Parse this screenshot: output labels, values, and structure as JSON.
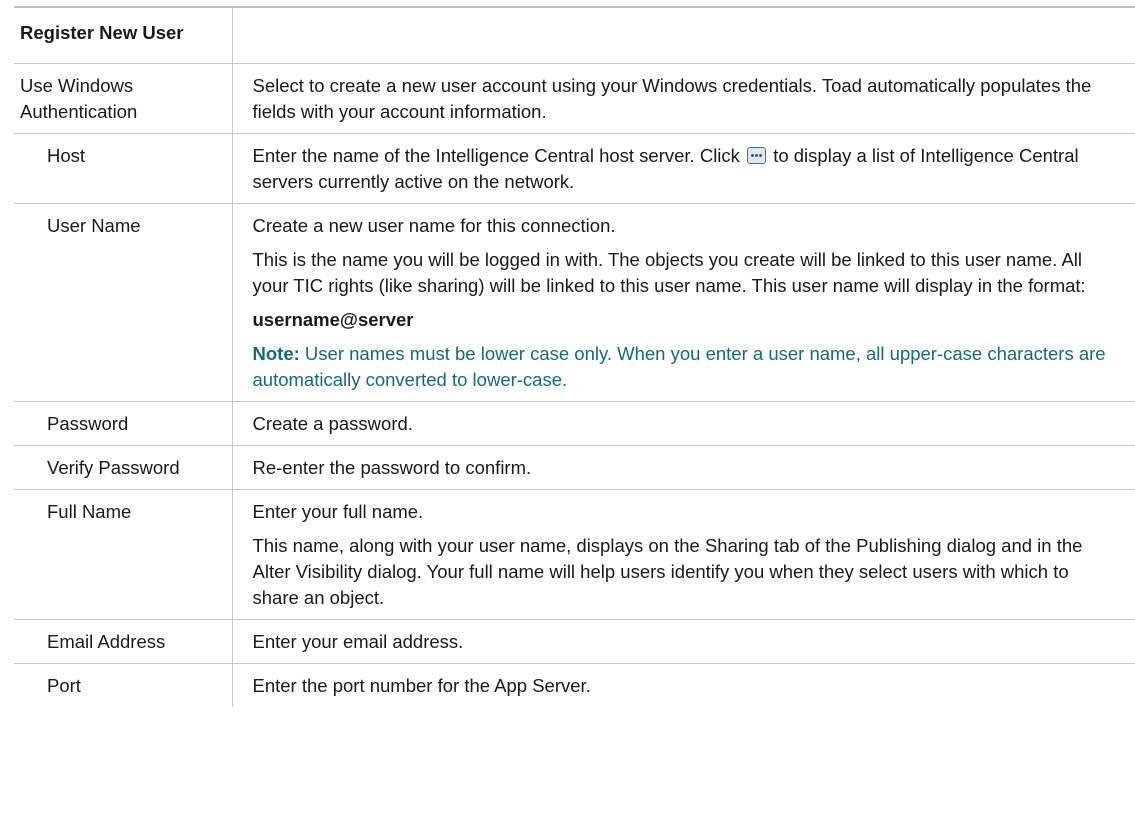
{
  "table": {
    "header": {
      "col1": "Register New User",
      "col2": ""
    },
    "rows": {
      "windows_auth": {
        "label": "Use Windows Authentication",
        "desc": "Select to create a new user account using your Windows credentials. Toad automatically populates the fields with your account information."
      },
      "host": {
        "label": "Host",
        "desc_before": "Enter the name of the Intelligence Central host server. Click",
        "desc_after": "to display a list of Intelligence Central servers currently active on the network.",
        "icon": "ellipsis-icon"
      },
      "user_name": {
        "label": "User Name",
        "p1": "Create a new user name for this connection.",
        "p2": "This is the name you will be logged in with. The objects you create will be linked to this user name. All your TIC rights (like sharing) will be linked to this user name. This user name will display in the format:",
        "format": "username@server",
        "note_label": "Note:",
        "note_text": "User names must be lower case only. When you enter a user name, all upper-case characters are automatically converted to lower-case."
      },
      "password": {
        "label": "Password",
        "desc": "Create a password."
      },
      "verify_password": {
        "label": "Verify Password",
        "desc": "Re-enter the password to confirm."
      },
      "full_name": {
        "label": "Full Name",
        "p1": "Enter your full name.",
        "p2": "This name, along with your user name, displays on the Sharing tab of the Publishing dialog and in the Alter Visibility dialog. Your full name will help users identify you when they select users with which to share an object."
      },
      "email": {
        "label": "Email Address",
        "desc": "Enter your email address."
      },
      "port": {
        "label": "Port",
        "desc": "Enter the port number for the App Server."
      }
    }
  },
  "colors": {
    "note": "#166a7a",
    "border": "#c8c8c8"
  }
}
